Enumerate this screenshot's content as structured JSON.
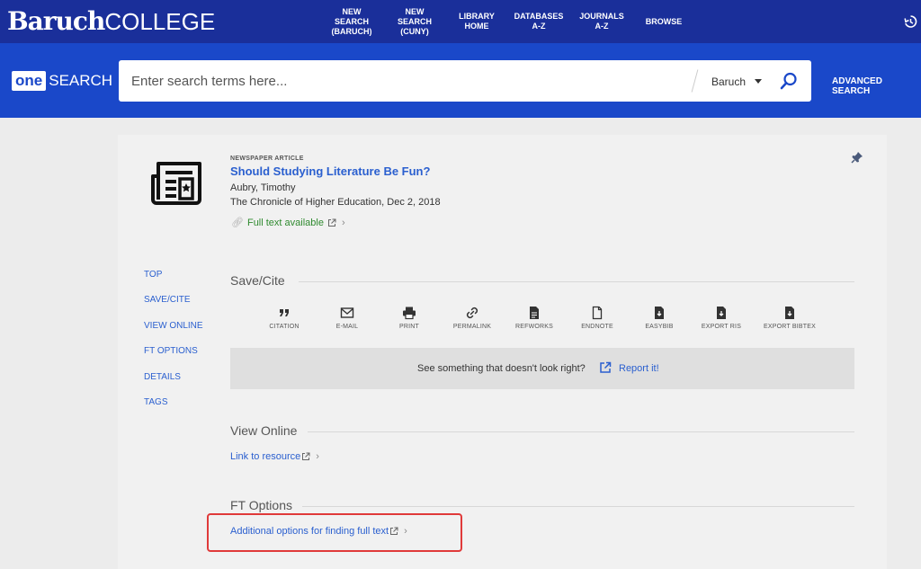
{
  "header": {
    "logo_bold": "Baruch",
    "logo_light": "COLLEGE",
    "nav": [
      {
        "label": "NEW\nSEARCH\n(BARUCH)"
      },
      {
        "label": "NEW\nSEARCH\n(CUNY)"
      },
      {
        "label": "LIBRARY\nHOME"
      },
      {
        "label": "DATABASES\nA-Z"
      },
      {
        "label": "JOURNALS\nA-Z"
      },
      {
        "label": "BROWSE"
      }
    ],
    "history_icon": "history-icon"
  },
  "search": {
    "brand_one": "one",
    "brand_search": "SEARCH",
    "placeholder": "Enter search terms here...",
    "scope": "Baruch",
    "advanced_label": "ADVANCED SEARCH"
  },
  "record": {
    "type": "NEWSPAPER ARTICLE",
    "title": "Should Studying Literature Be Fun?",
    "author": "Aubry, Timothy",
    "source": "The Chronicle of Higher Education, Dec 2, 2018",
    "fulltext": "Full text available"
  },
  "sidenav": [
    "TOP",
    "SAVE/CITE",
    "VIEW ONLINE",
    "FT OPTIONS",
    "DETAILS",
    "TAGS"
  ],
  "save_cite": {
    "title": "Save/Cite",
    "actions": [
      {
        "label": "CITATION",
        "icon": "quote-icon"
      },
      {
        "label": "E-MAIL",
        "icon": "email-icon"
      },
      {
        "label": "PRINT",
        "icon": "print-icon"
      },
      {
        "label": "PERMALINK",
        "icon": "link-icon"
      },
      {
        "label": "REFWORKS",
        "icon": "document-icon"
      },
      {
        "label": "ENDNOTE",
        "icon": "document-outline-icon"
      },
      {
        "label": "EASYBIB",
        "icon": "file-export-icon"
      },
      {
        "label": "EXPORT RIS",
        "icon": "file-export-icon"
      },
      {
        "label": "EXPORT BIBTEX",
        "icon": "file-export-icon"
      }
    ],
    "report_text": "See something that doesn't look right?",
    "report_link": "Report it!"
  },
  "view_online": {
    "title": "View Online",
    "link": "Link to resource"
  },
  "ft_options": {
    "title": "FT Options",
    "link": "Additional options for finding full text"
  },
  "colors": {
    "topbar": "#1a2f9a",
    "searchband": "#1a48c9",
    "link": "#2a5fcf",
    "fulltext_green": "#2f8a2f",
    "highlight": "#e03a3a"
  }
}
